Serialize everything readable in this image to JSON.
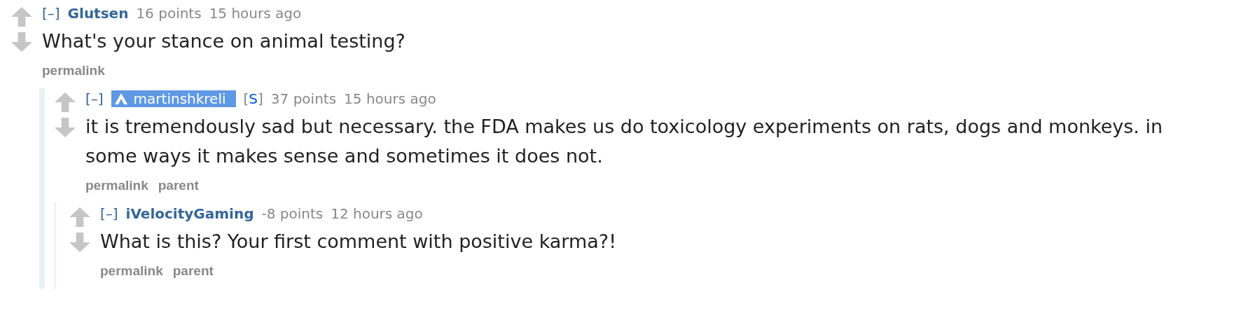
{
  "comments": [
    {
      "collapse": "[–]",
      "author": "Glutsen",
      "kind": "plain",
      "score": "16 points",
      "time": "15 hours ago",
      "body": "What's your stance on animal testing?",
      "links": [
        "permalink"
      ],
      "children": [
        {
          "collapse": "[–]",
          "author": "martinshkreli",
          "kind": "highlighted",
          "submitter": {
            "open": "[",
            "mark": "S",
            "close": "]"
          },
          "score": "37 points",
          "time": "15 hours ago",
          "body": "it is tremendously sad but necessary. the FDA makes us do toxicology experiments on rats, dogs and monkeys. in some ways it makes sense and sometimes it does not.",
          "links": [
            "permalink",
            "parent"
          ],
          "children": [
            {
              "collapse": "[–]",
              "author": "iVelocityGaming",
              "kind": "plain",
              "score": "-8 points",
              "time": "12 hours ago",
              "body": "What is this? Your first comment with positive karma?!",
              "links": [
                "permalink",
                "parent"
              ]
            }
          ]
        }
      ]
    }
  ]
}
